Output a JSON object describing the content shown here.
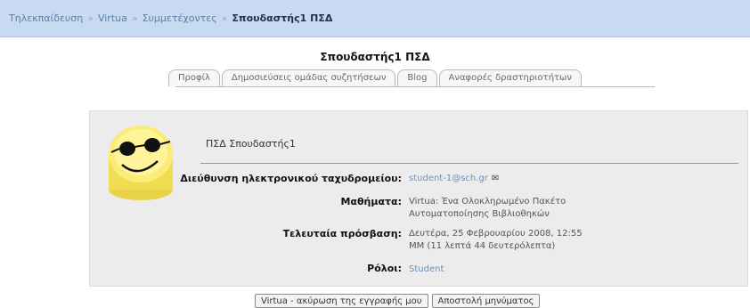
{
  "breadcrumb": {
    "items": [
      "Τηλεκπαίδευση",
      "Virtua",
      "Συμμετέχοντες"
    ],
    "separator": "»",
    "current": "Σπουδαστής1 ΠΣΔ"
  },
  "page_title": "Σπουδαστής1 ΠΣΔ",
  "tabs": [
    "Προφίλ",
    "Δημοσιεύσεις ομάδας συζητήσεων",
    "Blog",
    "Αναφορές δραστηριοτήτων"
  ],
  "profile": {
    "avatar_icon": "smiley-sunglasses-icon",
    "fullname": "ΠΣΔ Σπουδαστής1",
    "email_label": "Διεύθυνση ηλεκτρονικού ταχυδρομείου:",
    "email": "student-1@sch.gr",
    "email_icon": "✉",
    "courses_label": "Μαθήματα:",
    "courses_line1": "Virtua: Ένα Ολοκληρωμένο Πακέτο",
    "courses_line2": "Αυτοματοποίησης Βιβλιοθηκών",
    "lastaccess_label": "Τελευταία πρόσβαση:",
    "lastaccess_line1": "Δευτέρα, 25 Φεβρουαρίου 2008, 12:55",
    "lastaccess_line2": "ΜΜ  (11 λεπτά 44 δευτερόλεπτα)",
    "roles_label": "Ρόλοι:",
    "role": "Student"
  },
  "actions": {
    "unenrol": "Virtua - ακύρωση της εγγραφής μου",
    "message": "Αποστολή μηνύματος"
  },
  "colors": {
    "navbar_bg": "#c7daf2",
    "link": "#6f8fb4",
    "panel_bg": "#ececec"
  }
}
